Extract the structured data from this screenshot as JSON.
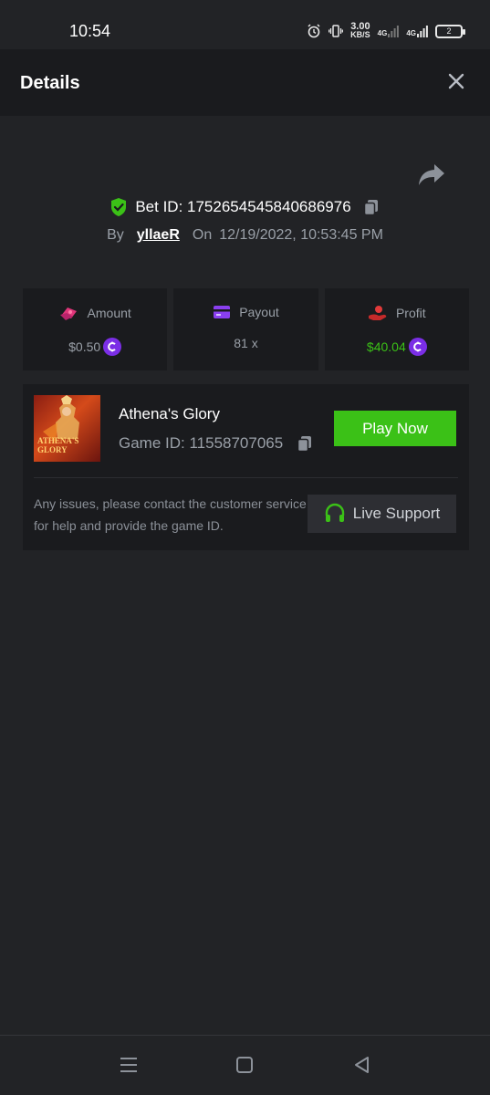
{
  "status_bar": {
    "time": "10:54",
    "net_speed_value": "3.00",
    "net_speed_unit": "KB/S",
    "network_label_1": "4G",
    "network_label_2": "4G",
    "battery_level": "2"
  },
  "header": {
    "title": "Details"
  },
  "bet": {
    "id_label": "Bet ID: 1752654545840686976",
    "by_label": "By",
    "user": "yllaeR",
    "on_label": "On",
    "date": "12/19/2022, 10:53:45 PM"
  },
  "stats": [
    {
      "label": "Amount",
      "value": "$0.50",
      "icon": "amount-icon"
    },
    {
      "label": "Payout",
      "value": "81 x",
      "icon": "card-icon"
    },
    {
      "label": "Profit",
      "value": "$40.04",
      "icon": "profit-icon"
    }
  ],
  "game": {
    "name": "Athena's Glory",
    "id_label": "Game ID: 11558707065",
    "thumb_text_1": "ATHENA'S",
    "thumb_text_2": "GLORY",
    "play_label": "Play Now",
    "issue_text": "Any issues, please contact the customer service for help and provide the game ID.",
    "support_label": "Live Support"
  },
  "colors": {
    "accent_green": "#3bc117",
    "coin_purple": "#7b2ee6",
    "background": "#222326",
    "card": "#1a1b1e"
  }
}
